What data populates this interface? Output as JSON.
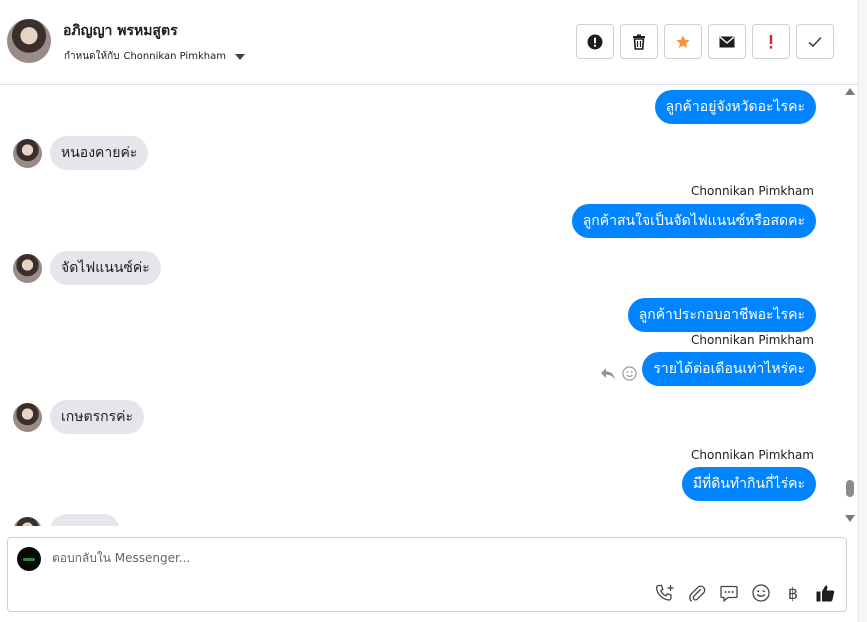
{
  "header": {
    "contact_name": "อภิญญา พรหมสูตร",
    "assign_prefix": "กำหนดให้กับ",
    "assignee": "Chonnikan Pimkham",
    "actions": [
      {
        "name": "spam-button",
        "icon": "exclamation-circle-icon"
      },
      {
        "name": "delete-button",
        "icon": "trash-icon"
      },
      {
        "name": "star-button",
        "icon": "star-icon",
        "color": "#f7923a"
      },
      {
        "name": "mark-unread-button",
        "icon": "envelope-icon"
      },
      {
        "name": "follow-up-button",
        "icon": "exclamation-icon",
        "color": "#e02020"
      },
      {
        "name": "mark-done-button",
        "icon": "check-icon"
      }
    ]
  },
  "messages": [
    {
      "direction": "out",
      "text": "ลูกค้าอยู่จังหวัดอะไรคะ"
    },
    {
      "direction": "in",
      "text": "หนองคายค่ะ"
    },
    {
      "direction": "out",
      "sender": "Chonnikan Pimkham",
      "text": "ลูกค้าสนใจเป็นจัดไฟแนนซ์หรือสดคะ"
    },
    {
      "direction": "in",
      "text": "จัดไฟแนนซ์ค่ะ"
    },
    {
      "direction": "out",
      "text": "ลูกค้าประกอบอาชีพอะไรคะ"
    },
    {
      "direction": "out",
      "sender": "Chonnikan Pimkham",
      "text": "รายได้ต่อเดือนเท่าไหร่คะ"
    },
    {
      "direction": "in",
      "text": "เกษตรกรค่ะ"
    },
    {
      "direction": "out",
      "sender": "Chonnikan Pimkham",
      "text": "มีที่ดินทำกินกี่ไร่คะ"
    }
  ],
  "composer": {
    "placeholder": "ตอบกลับใน Messenger...",
    "tools": [
      "phone-add-icon",
      "paperclip-icon",
      "saved-reply-icon",
      "emoji-icon",
      "baht-icon",
      "thumbs-up-icon"
    ],
    "baht_symbol": "฿"
  },
  "colors": {
    "outgoing_bubble": "#0084ff",
    "incoming_bubble": "#e4e6eb",
    "star": "#f7923a",
    "alert": "#e02020"
  }
}
